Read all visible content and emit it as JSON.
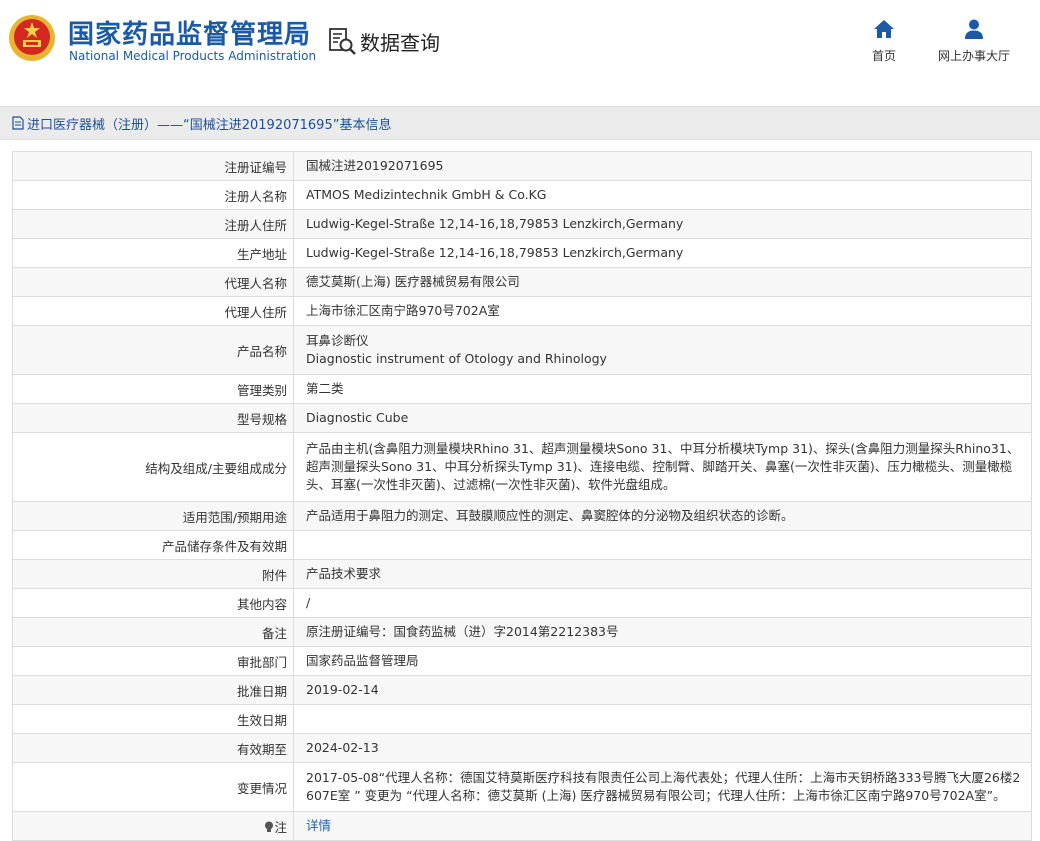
{
  "header": {
    "agency_cn": "国家药品监督管理局",
    "agency_en": "National Medical Products Administration",
    "query_title": "数据查询",
    "nav": [
      {
        "label": "首页",
        "icon": "home-icon"
      },
      {
        "label": "网上办事大厅",
        "icon": "user-icon"
      }
    ]
  },
  "title_bar": {
    "text": "进口医疗器械（注册）——“国械注进20192071695”基本信息",
    "icon": "document-icon"
  },
  "record": {
    "reg_no": {
      "label": "注册证编号",
      "value": "国械注进20192071695"
    },
    "registrant": {
      "label": "注册人名称",
      "value": "ATMOS Medizintechnik GmbH & Co.KG"
    },
    "registrant_addr": {
      "label": "注册人住所",
      "value": "Ludwig-Kegel-Straße 12,14-16,18,79853 Lenzkirch,Germany"
    },
    "mfg_addr": {
      "label": "生产地址",
      "value": "Ludwig-Kegel-Straße 12,14-16,18,79853 Lenzkirch,Germany"
    },
    "agent": {
      "label": "代理人名称",
      "value": "德艾莫斯(上海) 医疗器械贸易有限公司"
    },
    "agent_addr": {
      "label": "代理人住所",
      "value": "上海市徐汇区南宁路970号702A室"
    },
    "product_name": {
      "label": "产品名称",
      "value_cn": "耳鼻诊断仪",
      "value_en": "Diagnostic instrument of Otology and Rhinology"
    },
    "category": {
      "label": "管理类别",
      "value": "第二类"
    },
    "model": {
      "label": "型号规格",
      "value": "Diagnostic Cube"
    },
    "composition": {
      "label": "结构及组成/主要组成成分",
      "value": "产品由主机(含鼻阻力测量模块Rhino 31、超声测量模块Sono 31、中耳分析模块Tymp 31)、探头(含鼻阻力测量探头Rhino31、超声测量探头Sono 31、中耳分析探头Tymp 31)、连接电缆、控制臂、脚踏开关、鼻塞(一次性非灭菌)、压力橄榄头、测量橄榄头、耳塞(一次性非灭菌)、过滤棉(一次性非灭菌)、软件光盘组成。"
    },
    "scope": {
      "label": "适用范围/预期用途",
      "value": "产品适用于鼻阻力的测定、耳鼓膜顺应性的测定、鼻窦腔体的分泌物及组织状态的诊断。"
    },
    "storage": {
      "label": "产品储存条件及有效期",
      "value": ""
    },
    "attachment": {
      "label": "附件",
      "value": "产品技术要求"
    },
    "other": {
      "label": "其他内容",
      "value": "/"
    },
    "remark": {
      "label": "备注",
      "value": "原注册证编号：国食药监械（进）字2014第2212383号"
    },
    "approval_dept": {
      "label": "审批部门",
      "value": "国家药品监督管理局"
    },
    "approval_date": {
      "label": "批准日期",
      "value": "2019-02-14"
    },
    "effective_date": {
      "label": "生效日期",
      "value": ""
    },
    "expiry": {
      "label": "有效期至",
      "value": "2024-02-13"
    },
    "changes": {
      "label": "变更情况",
      "value": "2017-05-08“代理人名称：德国艾特莫斯医疗科技有限责任公司上海代表处；代理人住所：上海市天钥桥路333号腾飞大厦26楼2607E室 ” 变更为 “代理人名称：德艾莫斯 (上海) 医疗器械贸易有限公司；代理人住所：上海市徐汇区南宁路970号702A室”。"
    },
    "note": {
      "label": "注",
      "value": "详情",
      "icon": "bulb-icon"
    }
  }
}
